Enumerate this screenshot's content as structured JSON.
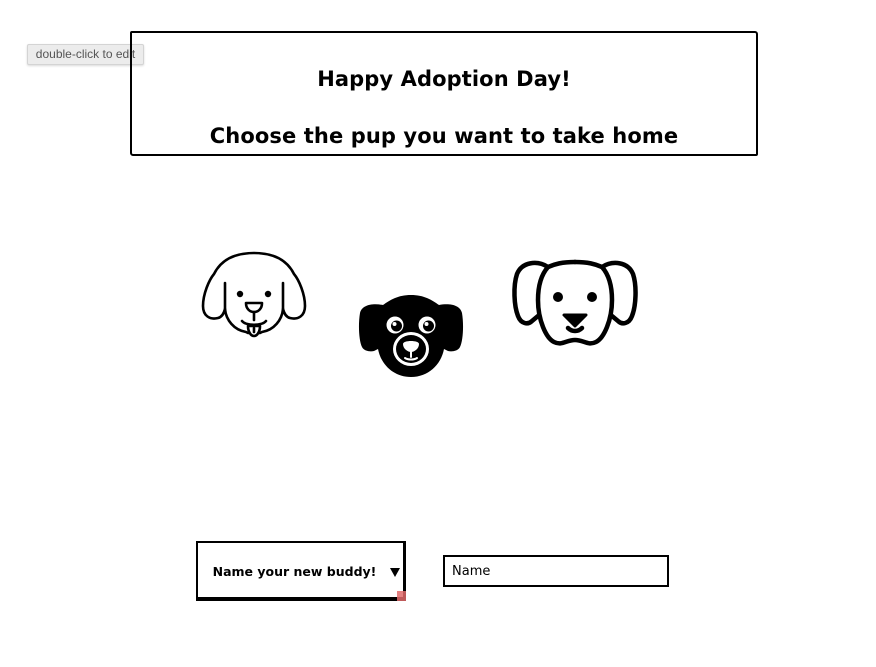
{
  "tooltip": {
    "text": "double-click to edit"
  },
  "header": {
    "line1": "Happy Adoption Day!",
    "line2": "Choose the pup you want to take home"
  },
  "dogs": [
    {
      "icon": "dog-tongue-outline-icon"
    },
    {
      "icon": "dog-solid-icon"
    },
    {
      "icon": "dog-outline-icon"
    }
  ],
  "form": {
    "select_label": "Name your new buddy!",
    "name_value": "Name"
  }
}
